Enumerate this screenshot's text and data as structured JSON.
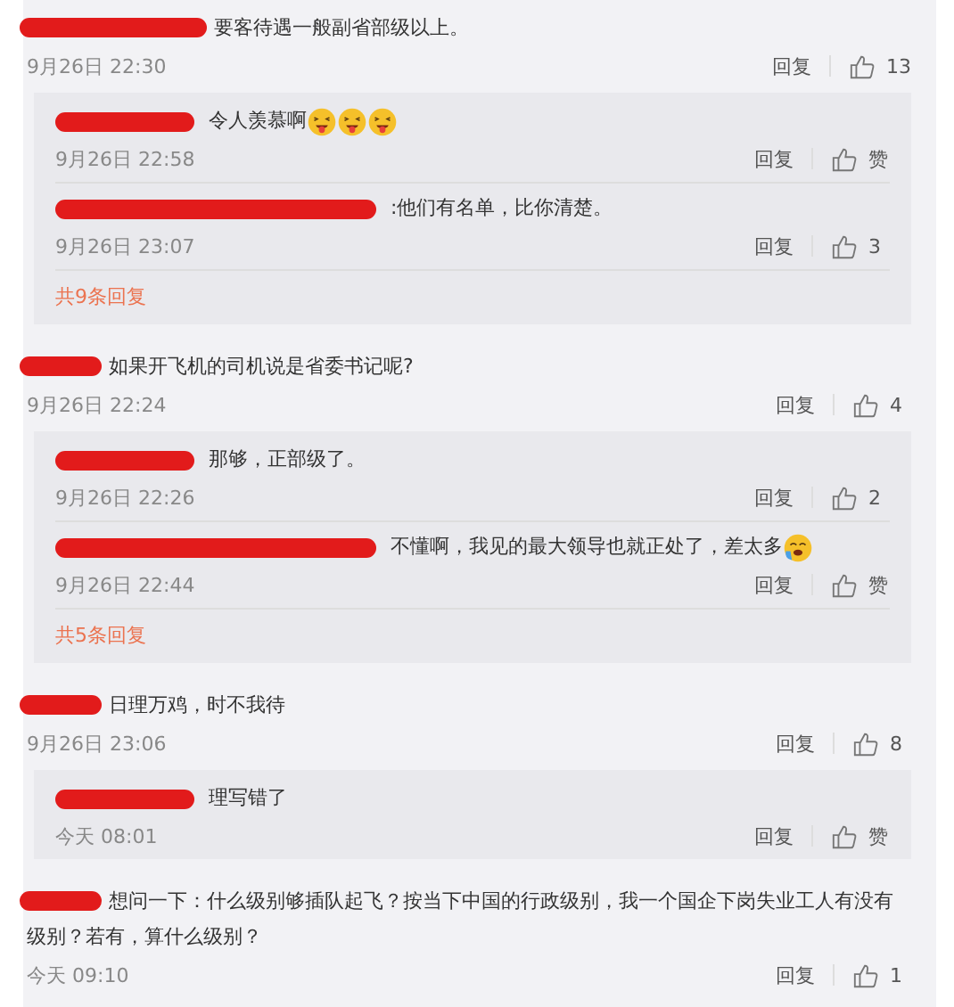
{
  "comments": [
    {
      "redaction": {
        "kind": "long"
      },
      "text": "要客待遇一般副省部级以上。",
      "time": "9月26日 22:30",
      "reply": "回复",
      "likes": "13",
      "replies": [
        {
          "redaction": {
            "kind": "medium"
          },
          "text": "令人羡慕啊",
          "emojis": [
            {
              "kind": "grin"
            },
            {
              "kind": "grin"
            },
            {
              "kind": "grin"
            }
          ],
          "time": "9月26日 22:58",
          "reply": "回复",
          "likes": "赞"
        },
        {
          "redaction": {
            "kind": "xlong"
          },
          "text": ":他们有名单，比你清楚。",
          "time": "9月26日 23:07",
          "reply": "回复",
          "likes": "3"
        }
      ],
      "more": "共9条回复"
    },
    {
      "redaction": {
        "kind": "short"
      },
      "text": "如果开飞机的司机说是省委书记呢?",
      "time": "9月26日 22:24",
      "reply": "回复",
      "likes": "4",
      "replies": [
        {
          "redaction": {
            "kind": "medium"
          },
          "text": "那够，正部级了。",
          "time": "9月26日 22:26",
          "reply": "回复",
          "likes": "2"
        },
        {
          "redaction": {
            "kind": "xlong"
          },
          "text": "不懂啊，我见的最大领导也就正处了，差太多",
          "emojis": [
            {
              "kind": "cry"
            }
          ],
          "time": "9月26日 22:44",
          "reply": "回复",
          "likes": "赞"
        }
      ],
      "more": "共5条回复"
    },
    {
      "redaction": {
        "kind": "short"
      },
      "text": "日理万鸡，时不我待",
      "time": "9月26日 23:06",
      "reply": "回复",
      "likes": "8",
      "replies": [
        {
          "redaction": {
            "kind": "medium"
          },
          "text": "理写错了",
          "time": "今天 08:01",
          "reply": "回复",
          "likes": "赞"
        }
      ]
    },
    {
      "redaction": {
        "kind": "short"
      },
      "text": "想问一下：什么级别够插队起飞？按当下中国的行政级别，我一个国企下岗失业工人有没有级别？若有，算什么级别？",
      "time": "今天 09:10",
      "reply": "回复",
      "likes": "1"
    }
  ]
}
